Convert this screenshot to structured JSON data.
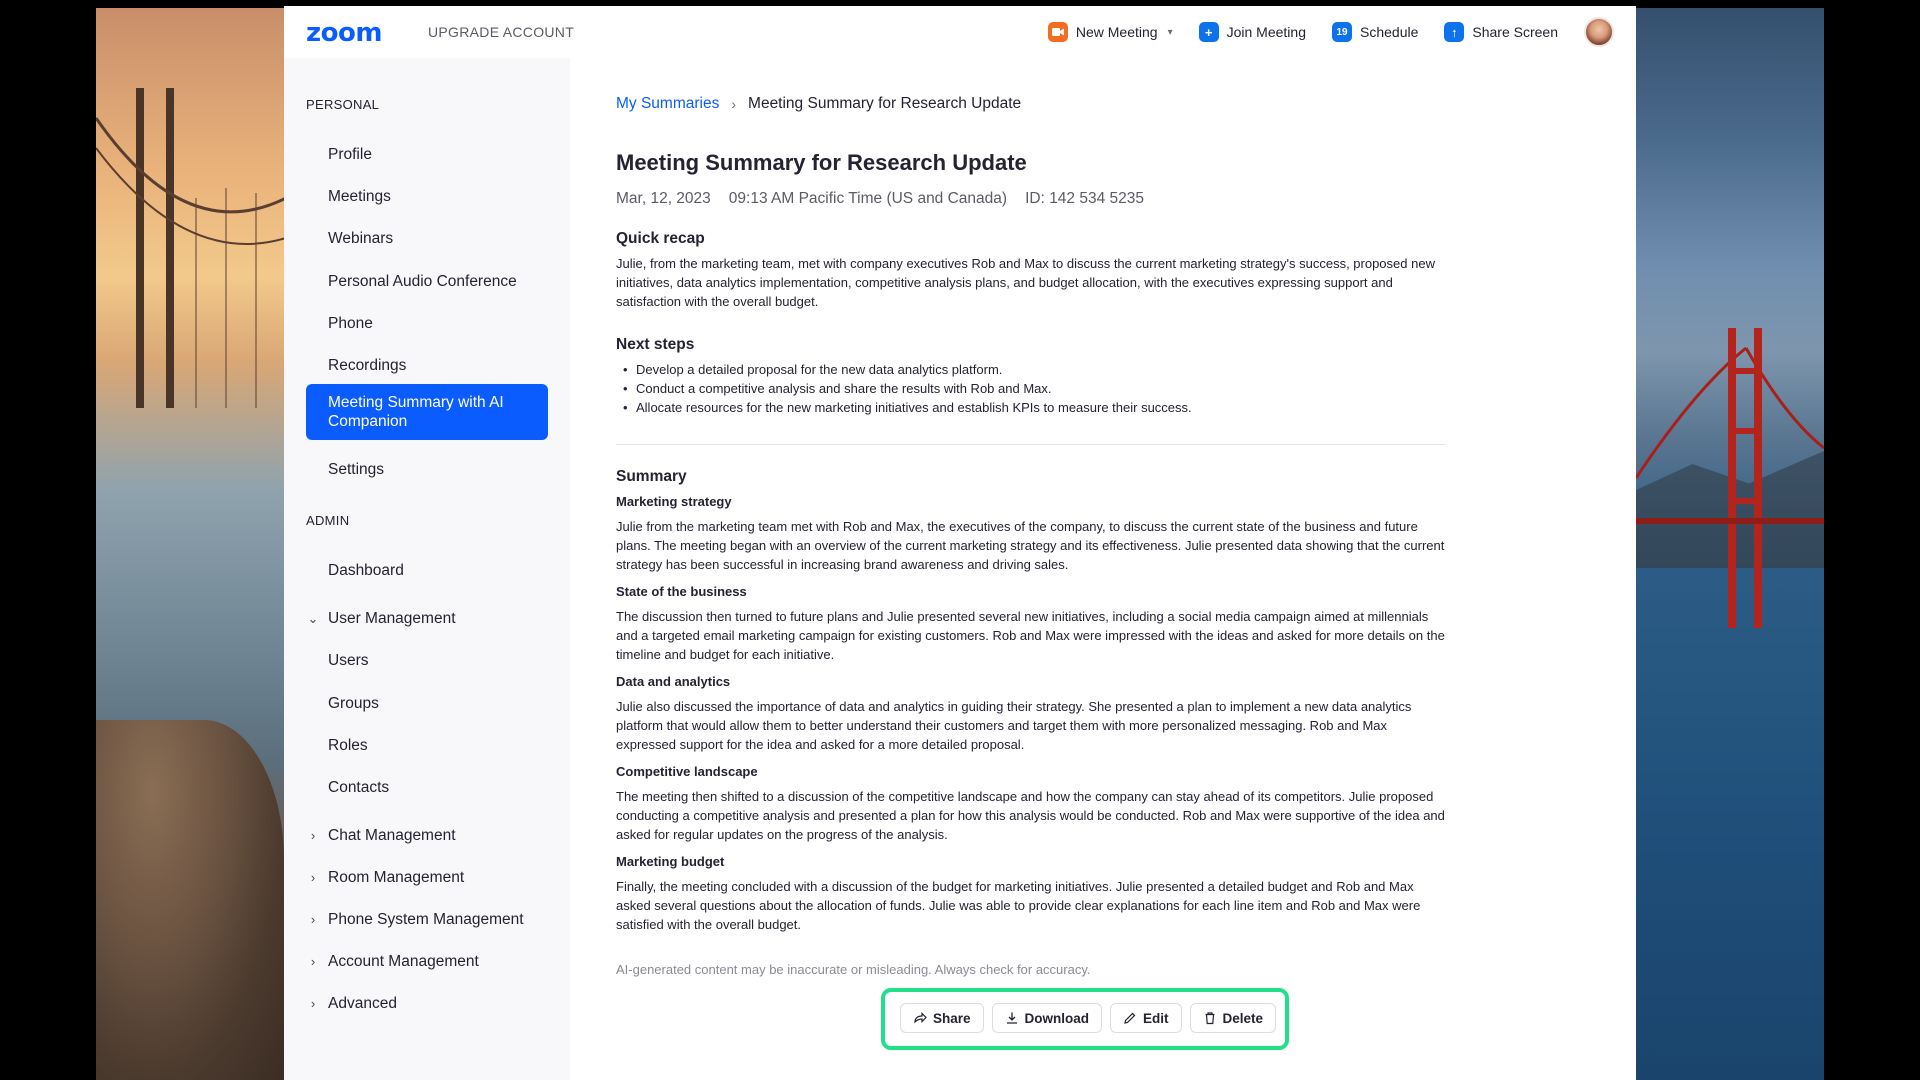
{
  "topbar": {
    "logo": "zoom",
    "upgrade": "UPGRADE ACCOUNT",
    "new_meeting": "New Meeting",
    "join_meeting": "Join Meeting",
    "schedule": "Schedule",
    "schedule_day": "19",
    "share_screen": "Share Screen"
  },
  "sidebar": {
    "personal_label": "PERSONAL",
    "personal": [
      "Profile",
      "Meetings",
      "Webinars",
      "Personal Audio Conference",
      "Phone",
      "Recordings"
    ],
    "active": "Meeting Summary with AI Companion",
    "settings": "Settings",
    "admin_label": "ADMIN",
    "dashboard": "Dashboard",
    "user_management": "User Management",
    "user_sub": [
      "Users",
      "Groups",
      "Roles",
      "Contacts"
    ],
    "collapsed": [
      "Chat Management",
      "Room Management",
      "Phone System Management",
      "Account Management",
      "Advanced"
    ]
  },
  "breadcrumb": {
    "link": "My Summaries",
    "current": "Meeting Summary for Research Update"
  },
  "summary": {
    "title": "Meeting Summary for Research Update",
    "date": "Mar, 12, 2023",
    "time": "09:13 AM Pacific Time (US and Canada)",
    "id": "ID: 142 534 5235",
    "recap_heading": "Quick recap",
    "recap_text": "Julie, from the marketing team, met with company executives Rob and Max to discuss the current marketing strategy's success, proposed new initiatives, data analytics implementation, competitive analysis plans, and budget allocation, with the executives expressing support and satisfaction with the overall budget.",
    "next_heading": "Next steps",
    "next_steps": [
      "Develop a detailed proposal for the new data analytics platform.",
      "Conduct a competitive analysis and share the results with Rob and Max.",
      "Allocate resources for the new marketing initiatives and establish KPIs to measure their success."
    ],
    "summary_heading": "Summary",
    "sections": [
      {
        "title": "Marketing strategy",
        "text": "Julie from the marketing team met with Rob and Max, the executives of the company, to discuss the current state of the business and future plans. The meeting began with an overview of the current marketing strategy and its effectiveness. Julie presented data showing that the current strategy has been successful in increasing brand awareness and driving sales."
      },
      {
        "title": "State of the business",
        "text": "The discussion then turned to future plans and Julie presented several new initiatives, including a social media campaign aimed at millennials and a targeted email marketing campaign for existing customers. Rob and Max were impressed with the ideas and asked for more details on the timeline and budget for each initiative."
      },
      {
        "title": "Data and analytics",
        "text": "Julie also discussed the importance of data and analytics in guiding their strategy. She presented a plan to implement a new data analytics platform that would allow them to better understand their customers and target them with more personalized messaging. Rob and Max expressed support for the idea and asked for a more detailed proposal."
      },
      {
        "title": "Competitive landscape",
        "text": "The meeting then shifted to a discussion of the competitive landscape and how the company can stay ahead of its competitors. Julie proposed conducting a competitive analysis and presented a plan for how this analysis would be conducted. Rob and Max were supportive of the idea and asked for regular updates on the progress of the analysis."
      },
      {
        "title": "Marketing budget",
        "text": "Finally, the meeting concluded with a discussion of the budget for marketing initiatives. Julie presented a detailed budget and Rob and Max asked several questions about the allocation of funds. Julie was able to provide clear explanations for each line item and Rob and Max were satisfied with the overall budget."
      }
    ],
    "disclaimer": "AI-generated content may be inaccurate or misleading. Always check for accuracy."
  },
  "actions": {
    "share": "Share",
    "download": "Download",
    "edit": "Edit",
    "delete": "Delete"
  },
  "colors": {
    "brand": "#0b5cff",
    "highlight": "#22e08a",
    "new_meeting_icon": "#f26d21",
    "action_icon": "#0e72ed"
  }
}
